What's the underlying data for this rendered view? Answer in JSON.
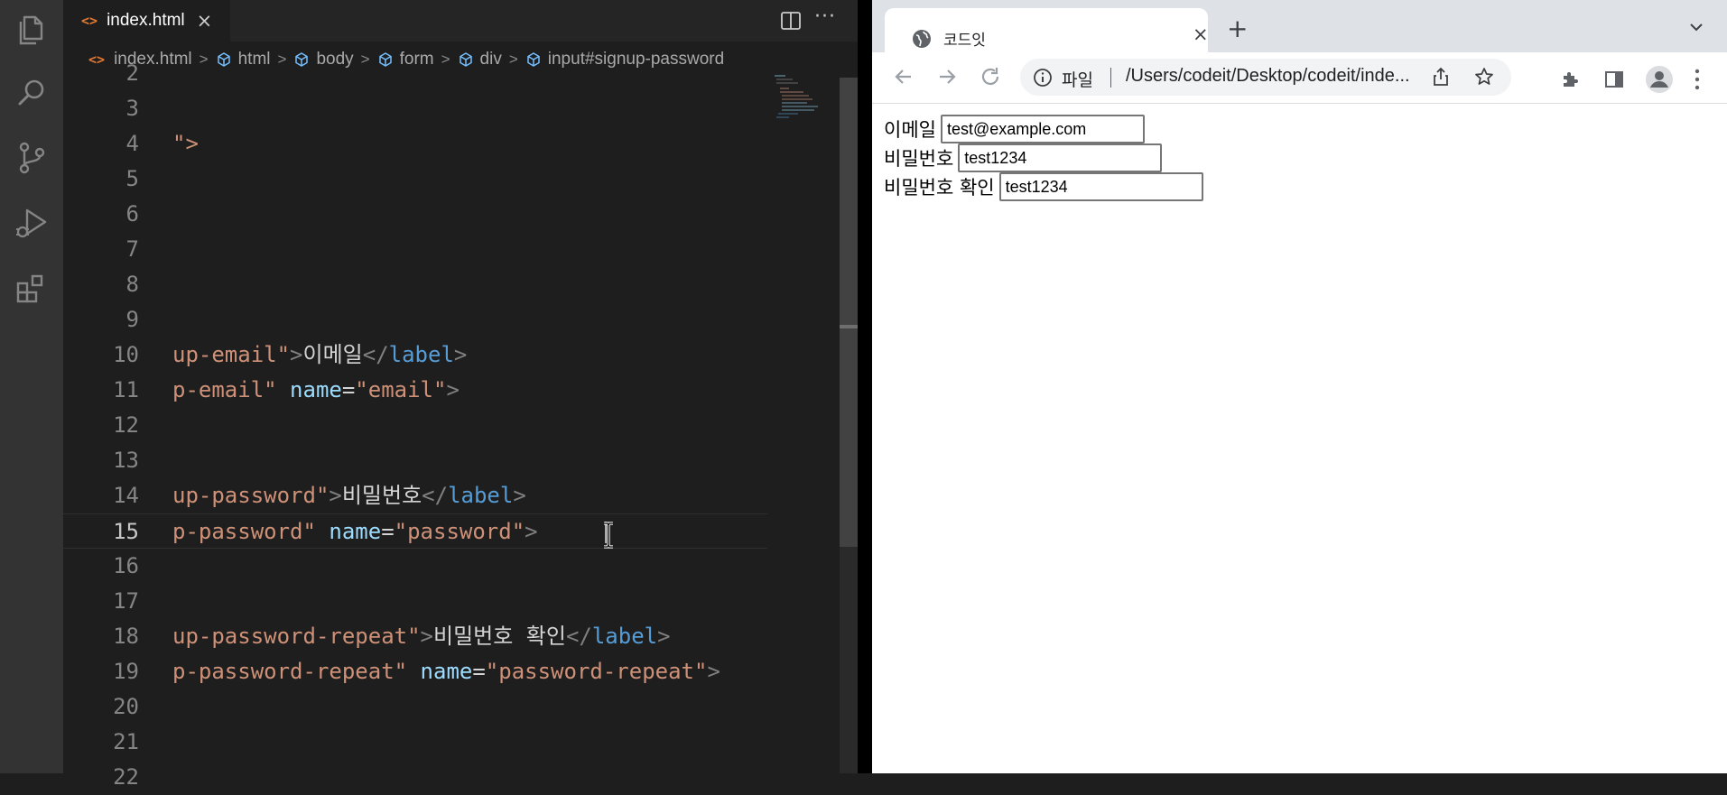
{
  "editor": {
    "tab": {
      "label": "index.html",
      "icon": "html-file-icon"
    },
    "breadcrumb": [
      "index.html",
      "html",
      "body",
      "form",
      "div",
      "input#signup-password"
    ],
    "code_lines": [
      {
        "num": "2",
        "text": ""
      },
      {
        "num": "3",
        "text": ""
      },
      {
        "num": "4",
        "text": "\">"
      },
      {
        "num": "5",
        "text": ""
      },
      {
        "num": "6",
        "text": ""
      },
      {
        "num": "7",
        "text": ""
      },
      {
        "num": "8",
        "text": ""
      },
      {
        "num": "9",
        "text": ""
      },
      {
        "num": "10",
        "seg": [
          "up-email\"",
          ">",
          "이메일",
          "</",
          "label",
          ">"
        ]
      },
      {
        "num": "11",
        "seg": [
          "p-email\"",
          " ",
          "name",
          "=",
          "\"email\"",
          ">"
        ]
      },
      {
        "num": "12",
        "text": ""
      },
      {
        "num": "13",
        "text": ""
      },
      {
        "num": "14",
        "seg": [
          "up-password\"",
          ">",
          "비밀번호",
          "</",
          "label",
          ">"
        ]
      },
      {
        "num": "15",
        "seg": [
          "p-password\"",
          " ",
          "name",
          "=",
          "\"password\"",
          ">"
        ]
      },
      {
        "num": "16",
        "text": ""
      },
      {
        "num": "17",
        "text": ""
      },
      {
        "num": "18",
        "seg": [
          "up-password-repeat\"",
          ">",
          "비밀번호 확인",
          "</",
          "label",
          ">"
        ]
      },
      {
        "num": "19",
        "seg": [
          "p-password-repeat\"",
          " ",
          "name",
          "=",
          "\"password-repeat\"",
          ">"
        ]
      },
      {
        "num": "20",
        "text": ""
      },
      {
        "num": "21",
        "text": ""
      },
      {
        "num": "22",
        "text": ""
      }
    ],
    "current_line": "15"
  },
  "browser": {
    "tab_title": "코드잇",
    "omnibox": {
      "scheme": "파일",
      "url": "/Users/codeit/Desktop/codeit/inde..."
    },
    "form": [
      {
        "label": "이메일",
        "value": "test@example.com"
      },
      {
        "label": "비밀번호",
        "value": "test1234"
      },
      {
        "label": "비밀번호 확인",
        "value": "test1234"
      }
    ]
  },
  "colors": {
    "editor_bg": "#1e1e1e",
    "string": "#ce9178",
    "attribute": "#9cdcfe",
    "tag": "#569cd6",
    "punct": "#808080",
    "html_icon": "#e37933"
  }
}
